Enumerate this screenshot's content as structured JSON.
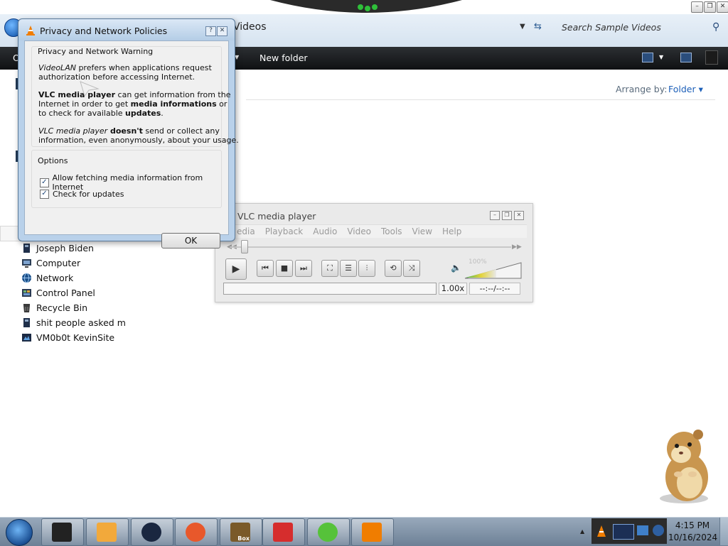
{
  "explorer": {
    "breadcrumb": "Videos",
    "search_placeholder": "Search Sample Videos",
    "window_controls": [
      "minimize-icon",
      "restore-icon",
      "close-icon"
    ],
    "commandbar": {
      "partial_item": "O",
      "new_folder": "New folder"
    },
    "arrange_by_label": "Arrange by:",
    "arrange_by_value": "Folder"
  },
  "sidebar": {
    "items": [
      {
        "label": "Joseph Biden",
        "icon": "user-folder-icon",
        "color": "#1f2f4a"
      },
      {
        "label": "Computer",
        "icon": "computer-icon",
        "color": "#2b3d55"
      },
      {
        "label": "Network",
        "icon": "network-icon",
        "color": "#1a4f88"
      },
      {
        "label": "Control Panel",
        "icon": "control-panel-icon",
        "color": "#2a3a52"
      },
      {
        "label": "Recycle Bin",
        "icon": "recycle-bin-icon",
        "color": "#3a3a3a"
      },
      {
        "label": "shit people asked m",
        "icon": "user-folder-icon",
        "color": "#1f2f4a"
      },
      {
        "label": "VM0b0t KevinSite",
        "icon": "website-icon",
        "color": "#1b2a44"
      }
    ]
  },
  "dialog": {
    "title": "Privacy and Network Policies",
    "warning_heading": "Privacy and Network Warning",
    "p1_em": "VideoLAN",
    "p1_rest1": " prefers when applications request",
    "p1_rest2": "authorization before accessing Internet.",
    "p2_bold1": "VLC media player",
    "p2_t1": " can get information from the",
    "p2_t2": "Internet in order to get ",
    "p2_bold2": "media informations",
    "p2_t3": " or",
    "p2_t4": "to check for available ",
    "p2_bold3": "updates",
    "p2_t5": ".",
    "p3_em": "VLC media player",
    "p3_bold": " doesn't",
    "p3_t1": " send or collect any",
    "p3_t2": "information, even anonymously, about your usage.",
    "options_heading": "Options",
    "options": [
      {
        "label": "Allow fetching media information from Internet",
        "checked": true
      },
      {
        "label": "Check for updates",
        "checked": true
      }
    ],
    "ok_label": "OK"
  },
  "vlc": {
    "title": "VLC media player",
    "menus": [
      "Media",
      "Playback",
      "Audio",
      "Video",
      "Tools",
      "View",
      "Help"
    ],
    "menu_first_visible": "edia",
    "volume": "100%",
    "volume_fraction": 1.0,
    "rate": "1.00x",
    "time": "--:--/--:--",
    "controls": [
      "play-icon",
      "previous-icon",
      "stop-icon",
      "next-icon",
      "fullscreen-icon",
      "playlist-icon",
      "extended-settings-icon",
      "loop-icon",
      "shuffle-icon"
    ]
  },
  "taskbar": {
    "buttons": [
      {
        "name": "explorer-taskbar-button",
        "color": "#222222"
      },
      {
        "name": "media-app-taskbar-button",
        "color": "#f2a93b"
      },
      {
        "name": "globe-app-taskbar-button",
        "color": "#1a2740"
      },
      {
        "name": "firefox-taskbar-button",
        "color": "#e8582b"
      },
      {
        "name": "bonzi-box-taskbar-button",
        "color": "#7a5a2a"
      },
      {
        "name": "pinned-app-taskbar-button",
        "color": "#d62d2d"
      },
      {
        "name": "cloud-app-taskbar-button",
        "color": "#56c23a"
      },
      {
        "name": "vlc-taskbar-button",
        "color": "#f07d00"
      }
    ],
    "bonzi_label": "Box",
    "clock_time": "4:15 PM",
    "clock_date": "10/16/2024"
  }
}
